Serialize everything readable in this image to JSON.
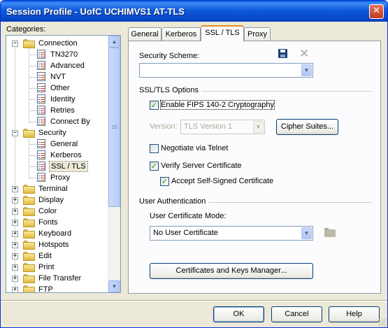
{
  "window": {
    "title": "Session Profile - UofC UCHIMVS1 AT-TLS",
    "close_glyph": "✕"
  },
  "categories": {
    "label": "Categories:",
    "items": [
      {
        "label": "Connection",
        "level": 0,
        "type": "folder",
        "expander": "−"
      },
      {
        "label": "TN3270",
        "level": 1,
        "type": "page"
      },
      {
        "label": "Advanced",
        "level": 1,
        "type": "page"
      },
      {
        "label": "NVT",
        "level": 1,
        "type": "page"
      },
      {
        "label": "Other",
        "level": 1,
        "type": "page"
      },
      {
        "label": "Identity",
        "level": 1,
        "type": "page"
      },
      {
        "label": "Retries",
        "level": 1,
        "type": "page"
      },
      {
        "label": "Connect By",
        "level": 1,
        "type": "page"
      },
      {
        "label": "Security",
        "level": 0,
        "type": "folder",
        "expander": "−"
      },
      {
        "label": "General",
        "level": 1,
        "type": "page"
      },
      {
        "label": "Kerberos",
        "level": 1,
        "type": "page"
      },
      {
        "label": "SSL / TLS",
        "level": 1,
        "type": "page",
        "selected": true
      },
      {
        "label": "Proxy",
        "level": 1,
        "type": "page"
      },
      {
        "label": "Terminal",
        "level": 0,
        "type": "folder",
        "expander": "+"
      },
      {
        "label": "Display",
        "level": 0,
        "type": "folder",
        "expander": "+"
      },
      {
        "label": "Color",
        "level": 0,
        "type": "folder",
        "expander": "+"
      },
      {
        "label": "Fonts",
        "level": 0,
        "type": "folder",
        "expander": "+"
      },
      {
        "label": "Keyboard",
        "level": 0,
        "type": "folder",
        "expander": "+"
      },
      {
        "label": "Hotspots",
        "level": 0,
        "type": "folder",
        "expander": "+"
      },
      {
        "label": "Edit",
        "level": 0,
        "type": "folder",
        "expander": "+"
      },
      {
        "label": "Print",
        "level": 0,
        "type": "folder",
        "expander": "+"
      },
      {
        "label": "File Transfer",
        "level": 0,
        "type": "folder",
        "expander": "+"
      },
      {
        "label": "FTP",
        "level": 0,
        "type": "folder",
        "expander": "+"
      }
    ]
  },
  "tabs": [
    {
      "label": "General"
    },
    {
      "label": "Kerberos"
    },
    {
      "label": "SSL / TLS",
      "active": true
    },
    {
      "label": "Proxy"
    }
  ],
  "ssl": {
    "security_scheme_label": "Security Scheme:",
    "security_scheme_value": "",
    "options_group": "SSL/TLS Options",
    "fips_label": "Enable FIPS 140-2 Cryptography",
    "fips_checked": true,
    "version_label": "Version:",
    "version_value": "TLS Version 1",
    "cipher_button": "Cipher Suites...",
    "negotiate_label": "Negotiate via Telnet",
    "negotiate_checked": false,
    "verify_label": "Verify Server Certificate",
    "verify_checked": true,
    "accept_label": "Accept Self-Signed Certificate",
    "accept_checked": true,
    "user_auth_group": "User Authentication",
    "cert_mode_label": "User Certificate Mode:",
    "cert_mode_value": "No User Certificate",
    "cert_manager_button": "Certificates and Keys Manager..."
  },
  "buttons": {
    "ok": "OK",
    "cancel": "Cancel",
    "help": "Help"
  },
  "icons": {
    "check": "✓",
    "arrow_down": "▼",
    "arrow_up": "▲",
    "delete": "✕"
  }
}
